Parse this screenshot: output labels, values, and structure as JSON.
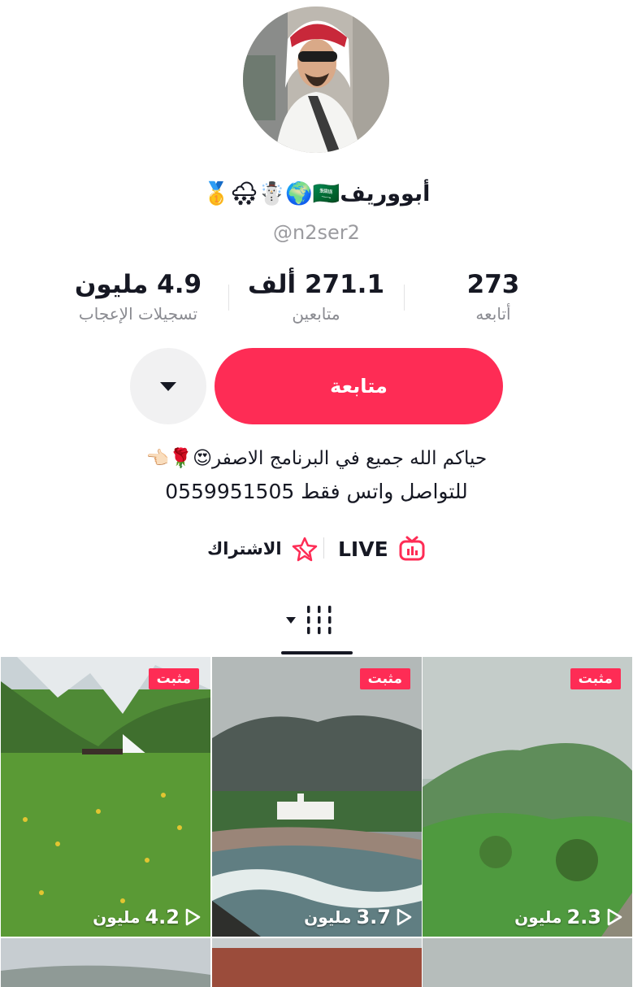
{
  "profile": {
    "display_name": "أبووريف🇸🇦🌍☃️🌨🥇",
    "handle": "@n2ser2"
  },
  "stats": {
    "likes": {
      "value": "4.9 مليون",
      "label": "تسجيلات الإعجاب"
    },
    "followers": {
      "value": "271.1 ألف",
      "label": "متابعين"
    },
    "following": {
      "value": "273",
      "label": "أتابعه"
    }
  },
  "actions": {
    "follow_label": "متابعة",
    "more_icon": "caret-down-icon"
  },
  "bio": {
    "line1": "حياكم الله جميع في البرنامج الاصفر😍🌹👈🏻",
    "line2": "للتواصل واتس فقط 0559951505"
  },
  "links": {
    "live_label": "LIVE",
    "subscribe_label": "الاشتراك"
  },
  "videos": [
    {
      "pinned_label": "مثبت",
      "views": "2.3",
      "views_unit": "مليون"
    },
    {
      "pinned_label": "مثبت",
      "views": "3.7",
      "views_unit": "مليون"
    },
    {
      "pinned_label": "مثبت",
      "views": "4.2",
      "views_unit": "مليون"
    }
  ],
  "colors": {
    "accent": "#fe2c55",
    "text": "#161823",
    "muted": "#8a8b91"
  }
}
